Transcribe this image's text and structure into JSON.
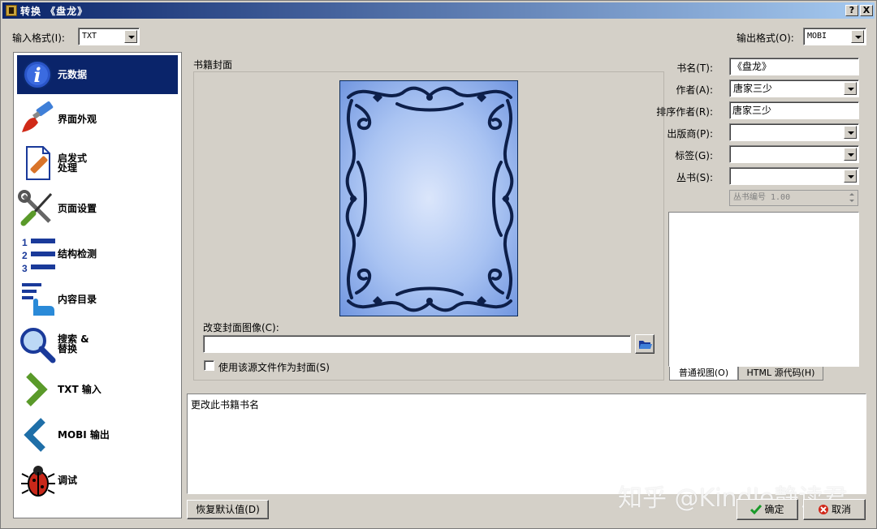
{
  "window": {
    "title": "转换 《盘龙》",
    "help_btn": "?",
    "close_btn": "X"
  },
  "input_format": {
    "label": "输入格式(I):",
    "value": "TXT"
  },
  "output_format": {
    "label": "输出格式(O):",
    "value": "MOBI"
  },
  "sidebar": {
    "items": [
      {
        "label": "元数据",
        "icon": "info-icon",
        "selected": true
      },
      {
        "label": "界面外观",
        "icon": "paintbrush-icon"
      },
      {
        "label": "启发式\n处理",
        "icon": "document-wand-icon"
      },
      {
        "label": "页面设置",
        "icon": "wrench-screwdriver-icon"
      },
      {
        "label": "结构检测",
        "icon": "numbered-list-icon"
      },
      {
        "label": "内容目录",
        "icon": "toc-hand-icon"
      },
      {
        "label": "搜索 &\n替换",
        "icon": "magnifier-icon"
      },
      {
        "label": "TXT 输入",
        "icon": "chevron-right-icon"
      },
      {
        "label": "MOBI 输出",
        "icon": "chevron-left-icon"
      },
      {
        "label": "调试",
        "icon": "bug-icon"
      }
    ]
  },
  "cover": {
    "group_title": "书籍封面",
    "change_label": "改变封面图像(C):",
    "path_value": "",
    "use_source_label": "使用该源文件作为封面(S)"
  },
  "metadata": {
    "title_label": "书名(T):",
    "title_value": "《盘龙》",
    "author_label": "作者(A):",
    "author_value": "唐家三少",
    "author_sort_label": "排序作者(R):",
    "author_sort_value": "唐家三少",
    "publisher_label": "出版商(P):",
    "publisher_value": "",
    "tags_label": "标签(G):",
    "tags_value": "",
    "series_label": "丛书(S):",
    "series_value": "",
    "series_index": "丛书编号 1.00"
  },
  "comment_tabs": {
    "normal": "普通视图(O)",
    "html": "HTML 源代码(H)"
  },
  "help_text": "更改此书籍书名",
  "buttons": {
    "restore": "恢复默认值(D)",
    "ok": "确定",
    "cancel": "取消"
  },
  "watermark": "知乎 @Kindle静读君",
  "colors": {
    "selection": "#0a246a",
    "title_start": "#0a246a",
    "cover_blue": "#8fb0ee"
  }
}
